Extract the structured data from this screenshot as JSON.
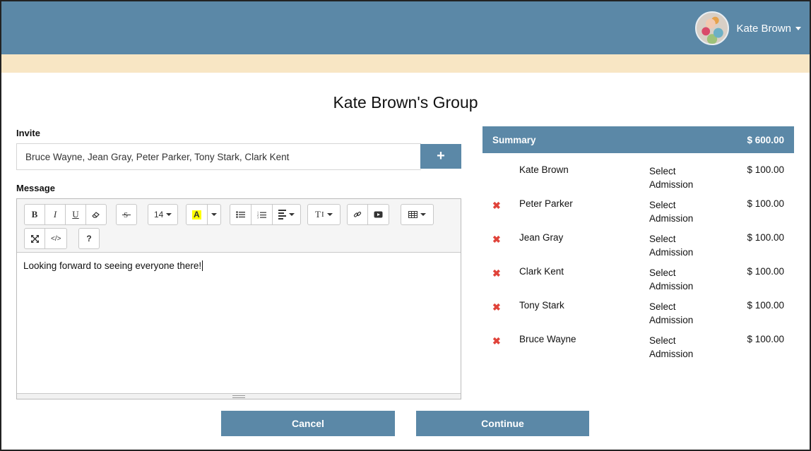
{
  "header": {
    "user_name": "Kate Brown",
    "avatar_icon": "user-avatar",
    "bar_color": "#5b88a7",
    "notice_color": "#f8e6c4"
  },
  "page": {
    "title": "Kate Brown's Group"
  },
  "invite": {
    "label": "Invite",
    "value": "Bruce Wayne, Jean Gray, Peter Parker, Tony Stark, Clark Kent",
    "add_label": "+"
  },
  "message": {
    "label": "Message",
    "body": "Looking forward to seeing everyone there!",
    "toolbar": {
      "bold": "B",
      "italic": "I",
      "underline": "U",
      "font_size": "14",
      "highlight": "A",
      "text_style": "T",
      "help": "?"
    }
  },
  "summary": {
    "title": "Summary",
    "total": "$ 600.00",
    "rows": [
      {
        "name": "Kate Brown",
        "admission": "Select Admission",
        "price": "$ 100.00",
        "removable": false
      },
      {
        "name": "Peter Parker",
        "admission": "Select Admission",
        "price": "$ 100.00",
        "removable": true,
        "remove_icon": "✖"
      },
      {
        "name": "Jean Gray",
        "admission": "Select Admission",
        "price": "$ 100.00",
        "removable": true,
        "remove_icon": "✖"
      },
      {
        "name": "Clark Kent",
        "admission": "Select Admission",
        "price": "$ 100.00",
        "removable": true,
        "remove_icon": "✖"
      },
      {
        "name": "Tony Stark",
        "admission": "Select Admission",
        "price": "$ 100.00",
        "removable": true,
        "remove_icon": "✖"
      },
      {
        "name": "Bruce Wayne",
        "admission": "Select Admission",
        "price": "$ 100.00",
        "removable": true,
        "remove_icon": "✖"
      }
    ]
  },
  "actions": {
    "cancel": "Cancel",
    "continue": "Continue"
  }
}
